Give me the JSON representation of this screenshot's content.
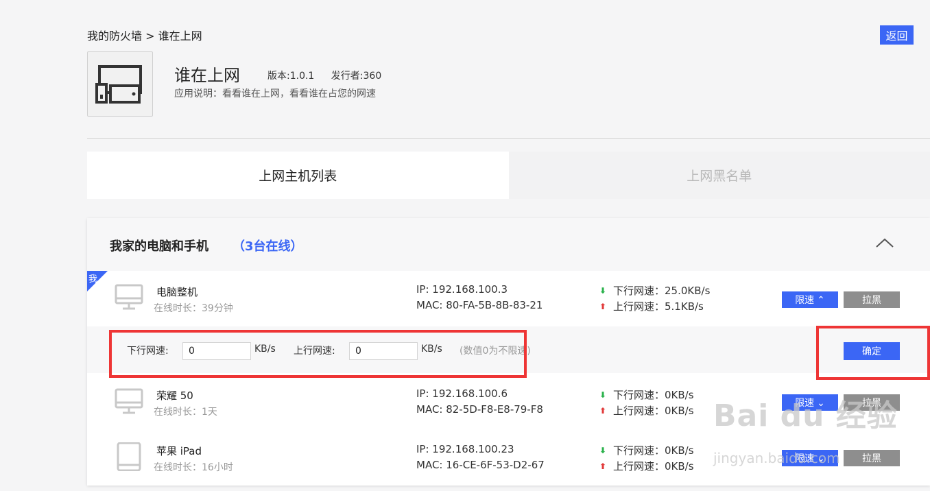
{
  "breadcrumb": {
    "parent": "我的防火墙",
    "separator": ">",
    "current": "谁在上网"
  },
  "back_label": "返回",
  "app": {
    "title": "谁在上网",
    "version": "版本:1.0.1",
    "publisher": "发行者:360",
    "description": "应用说明：看看谁在上网，看看谁在占您的网速"
  },
  "tabs": [
    {
      "label": "上网主机列表",
      "active": true
    },
    {
      "label": "上网黑名单",
      "active": false
    }
  ],
  "group": {
    "title": "我家的电脑和手机",
    "count": "（3台在线）"
  },
  "me_badge": "我",
  "devices": [
    {
      "name": "电脑整机",
      "online": "在线时长：39分钟",
      "ip": "IP: 192.168.100.3",
      "mac": "MAC: 80-FA-5B-8B-83-21",
      "down": "下行网速：25.0KB/s",
      "up": "上行网速：5.1KB/s",
      "limit_label": "限速 ⌃",
      "block_label": "拉黑",
      "icon": "monitor-icon"
    },
    {
      "name": "荣耀 50",
      "online": "在线时长：1天",
      "ip": "IP: 192.168.100.6",
      "mac": "MAC: 82-5D-F8-E8-79-F8",
      "down": "下行网速：0KB/s",
      "up": "上行网速：0KB/s",
      "limit_label": "限速 ⌄",
      "block_label": "拉黑",
      "icon": "monitor-icon"
    },
    {
      "name": "苹果 iPad",
      "online": "在线时长：16小时",
      "ip": "IP: 192.168.100.23",
      "mac": "MAC: 16-CE-6F-53-D2-67",
      "down": "下行网速：0KB/s",
      "up": "上行网速：0KB/s",
      "limit_label": "限速 ⌄",
      "block_label": "拉黑",
      "icon": "tablet-icon"
    }
  ],
  "limit_form": {
    "down_label": "下行网速:",
    "down_value": "0",
    "up_label": "上行网速:",
    "up_value": "0",
    "unit": "KB/s",
    "hint": "(数值0为不限速)",
    "confirm_label": "确定"
  },
  "watermark": {
    "text": "Bai du 经验",
    "sub": "jingyan.baidu.com"
  },
  "colors": {
    "accent": "#3b66f5",
    "highlight": "#ee3535",
    "block_button": "#8e8e8e"
  }
}
